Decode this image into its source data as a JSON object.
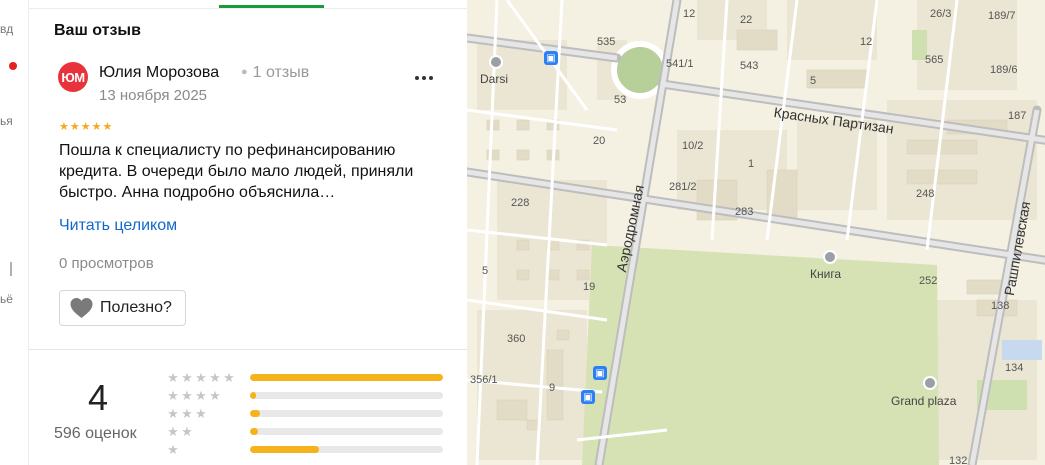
{
  "rail": {
    "fragments": [
      "вд",
      "ья",
      "|",
      "ьё"
    ]
  },
  "review": {
    "section_title": "Ваш отзыв",
    "avatar_initials": "ЮМ",
    "author_name": "Юлия Морозова",
    "author_reviews": "1 отзыв",
    "date": "13 ноября 2025",
    "rating_stars": 5,
    "text": "Пошла к специалисту по рефинансированию кредита. В очереди было мало людей, приняли быстро. Анна подробно объяснила…",
    "read_more": "Читать целиком",
    "views": "0 просмотров",
    "helpful_label": "Полезно?"
  },
  "summary": {
    "score": "4",
    "count_label": "596 оценок",
    "distribution": [
      {
        "stars": 5,
        "fraction": 1.0
      },
      {
        "stars": 4,
        "fraction": 0.03
      },
      {
        "stars": 3,
        "fraction": 0.05
      },
      {
        "stars": 2,
        "fraction": 0.04
      },
      {
        "stars": 1,
        "fraction": 0.36
      }
    ]
  },
  "map": {
    "labels": {
      "darsi": "Darsi",
      "n12": "12",
      "n22": "22",
      "n26_3": "26/3",
      "n189_7": "189/7",
      "n535": "535",
      "n541_1": "541/1",
      "n543": "543",
      "n565": "565",
      "n189_6": "189/6",
      "n53": "53",
      "n20": "20",
      "n10_2": "10/2",
      "n1": "1",
      "n281_2": "281/2",
      "n283": "283",
      "n248": "248",
      "n187": "187",
      "n228": "228",
      "n5": "5",
      "n19": "19",
      "n252": "252",
      "n138": "138",
      "n360": "360",
      "n356_1": "356/1",
      "n9": "9",
      "n134": "134",
      "n132": "132",
      "street_krasnyh": "Красных Партизан",
      "street_aerodromnaya": "Аэродромная",
      "street_rashpilevskaya": "Рашпилевская",
      "poi_kniga": "Книга",
      "poi_grand": "Grand plaza"
    }
  }
}
